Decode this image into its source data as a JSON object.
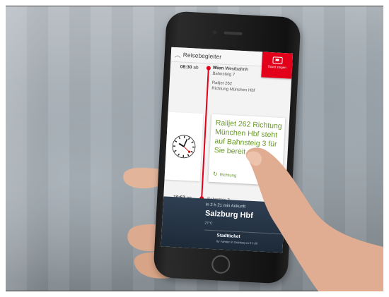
{
  "app": {
    "title": "Reisebegleiter",
    "ticket_button_label": "Ticket zeigen"
  },
  "departure": {
    "time": "08:30",
    "suffix": "ab",
    "station": "Wien",
    "station_detail": "Westbahnh",
    "platform": "Bahnsteig 7",
    "train": "Railjet 262",
    "direction": "Richtung München Hbf"
  },
  "notification": {
    "message": "Railjet 262 Richtung München Hbf steht auf Bahnsteig 3 für Sie bereit",
    "link_label": "Richtung"
  },
  "arrival": {
    "time": "10:52",
    "suffix": "an",
    "platform": "Bahnsteig 3"
  },
  "destination": {
    "eta_text": "In 2 h 21 min Ankunft",
    "city": "Salzburg Hbf",
    "temperature": "27°C",
    "city_ticket_title": "Stadtticket",
    "city_ticket_sub": "für Fahrten in Salzburg zu € 1,00"
  },
  "colors": {
    "accent_red": "#e2001a",
    "message_green": "#6a9a2a",
    "dark_panel": "#2f3f52"
  },
  "icons": {
    "ticket": "ticket-icon",
    "clock": "station-clock-icon",
    "refresh": "refresh-icon",
    "chevron": "chevron-up-icon"
  }
}
